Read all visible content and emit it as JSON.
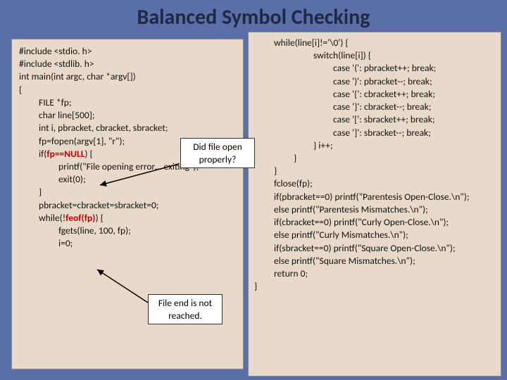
{
  "title": "Balanced Symbol Checking",
  "callout1": "Did file open properly?",
  "callout2": "File end is not reached.",
  "left": {
    "l0": "#include <stdio. h>",
    "l1": "#include <stdlib. h>",
    "l2": "int main(int argc, char *argv[])",
    "l3": "{",
    "l4": "FILE *fp;",
    "l5": "char line[500];",
    "l6": "int i, pbracket, cbracket, sbracket;",
    "l7": "fp=fopen(argv[1], \"r\");",
    "l8a": "if(",
    "l8b": "fp==NULL",
    "l8c": ") {",
    "l9": "printf(\"File opening error… exiting\");",
    "l10": "exit(0);",
    "l11": "}",
    "l12": "pbracket=cbracket=sbracket=0;",
    "l13a": "while(!",
    "l13b": "feof(fp)",
    "l13c": ") {",
    "l14": "fgets(line, 100, fp);",
    "l15": "i=0;"
  },
  "right": {
    "r0": "while(line[i]!='\\0') {",
    "r1": "switch(line[i]) {",
    "r2": "case '(': pbracket++; break;",
    "r3": "case ')': pbracket--; break;",
    "r4": "case '{': cbracket++; break;",
    "r5": "case '}': cbracket--; break;",
    "r6": "case '[': sbracket++; break;",
    "r7": "case ']': sbracket--; break;",
    "r8": "} i++;",
    "r9": "}",
    "r10": "}",
    "r11": "fclose(fp);",
    "r12": "if(pbracket==0) printf(\"Parentesis Open-Close.\\n\");",
    "r13": "else printf(\"Parentesis Mismatches.\\n\");",
    "r14": "if(cbracket==0) printf(\"Curly Open-Close.\\n\");",
    "r15": "else printf(\"Curly Mismatches.\\n\");",
    "r16": "if(sbracket==0) printf(\"Square Open-Close.\\n\");",
    "r17": "else printf(\"Square Mismatches.\\n\");",
    "r18": "return 0;",
    "r19": "}"
  }
}
